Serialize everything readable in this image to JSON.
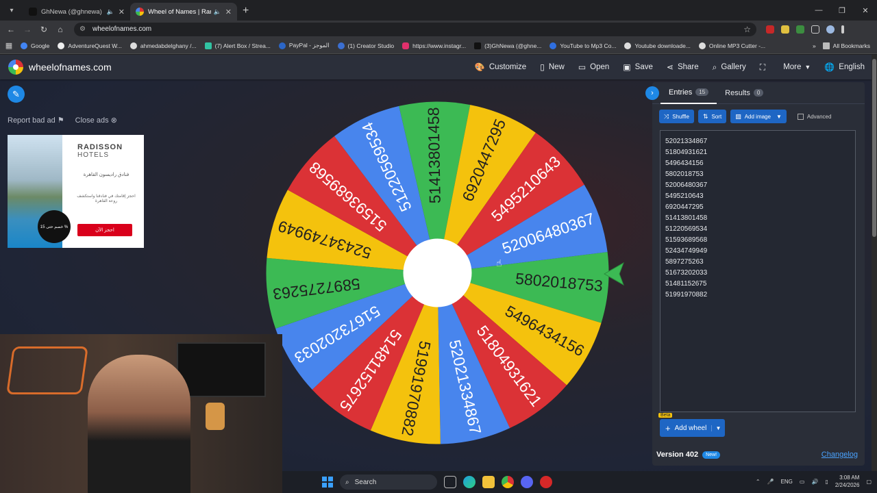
{
  "browser": {
    "tabs": [
      {
        "title": "GhNewa (@ghnewa) is LIVE",
        "active": false
      },
      {
        "title": "Wheel of Names | Random",
        "active": true
      }
    ],
    "url": "wheelofnames.com",
    "bookmarks": [
      "Google",
      "AdventureQuest W...",
      "ahmedabdelghany /...",
      "(7) Alert Box / Strea...",
      "PayPal - الموجز",
      "(1) Creator Studio",
      "https://www.instagr...",
      "(3)GhNewa (@ghne...",
      "YouTube to Mp3 Co...",
      "Youtube downloade...",
      "Online MP3 Cutter -..."
    ],
    "all_bookmarks": "All Bookmarks"
  },
  "app": {
    "brand": "wheelofnames.com",
    "menu": [
      {
        "label": "Customize",
        "icon": "palette-icon"
      },
      {
        "label": "New",
        "icon": "new-file-icon"
      },
      {
        "label": "Open",
        "icon": "folder-icon"
      },
      {
        "label": "Save",
        "icon": "save-icon"
      },
      {
        "label": "Share",
        "icon": "share-icon"
      },
      {
        "label": "Gallery",
        "icon": "search-icon"
      },
      {
        "label": "",
        "icon": "fullscreen-icon"
      },
      {
        "label": "More",
        "icon": "chevron-down-icon"
      },
      {
        "label": "English",
        "icon": "globe-icon"
      }
    ],
    "report_bad_ad": "Report bad ad",
    "close_ads": "Close ads"
  },
  "ad": {
    "brand": "RADISSON",
    "brand_sub": "HOTELS",
    "headline": "فنادق راديسون القاهرة",
    "body": "احجز إقامتك في فنادقنا واستكشف روعة القاهرة",
    "cta": "احجز الآن",
    "badge": "خصم حتى 15 %"
  },
  "wheel": {
    "slices": [
      {
        "label": "5802018753",
        "color": "#3cba54"
      },
      {
        "label": "5496434156",
        "color": "#f4c20d"
      },
      {
        "label": "51804931621",
        "color": "#db3236"
      },
      {
        "label": "52021334867",
        "color": "#4885ed"
      },
      {
        "label": "51991970882",
        "color": "#f4c20d"
      },
      {
        "label": "51481152675",
        "color": "#db3236"
      },
      {
        "label": "51673202033",
        "color": "#4885ed"
      },
      {
        "label": "5897275263",
        "color": "#3cba54"
      },
      {
        "label": "52434749949",
        "color": "#f4c20d"
      },
      {
        "label": "51593689568",
        "color": "#db3236"
      },
      {
        "label": "51220569534",
        "color": "#4885ed"
      },
      {
        "label": "51413801458",
        "color": "#3cba54"
      },
      {
        "label": "6920447295",
        "color": "#f4c20d"
      },
      {
        "label": "5495210643",
        "color": "#db3236"
      },
      {
        "label": "52006480367",
        "color": "#4885ed"
      }
    ]
  },
  "panel": {
    "tab_entries": "Entries",
    "entries_count": "15",
    "tab_results": "Results",
    "results_count": "0",
    "shuffle": "Shuffle",
    "sort": "Sort",
    "add_image": "Add image",
    "advanced": "Advanced",
    "entries": [
      "52021334867",
      "51804931621",
      "5496434156",
      "5802018753",
      "52006480367",
      "5495210643",
      "6920447295",
      "51413801458",
      "51220569534",
      "51593689568",
      "52434749949",
      "5897275263",
      "51673202033",
      "51481152675",
      "51991970882"
    ],
    "beta": "Beta",
    "add_wheel": "Add wheel",
    "version": "Version 402",
    "new_badge": "New!",
    "changelog": "Changelog"
  },
  "taskbar": {
    "search": "Search",
    "lang": "ENG",
    "time": "3:08 AM",
    "date": "2/24/2026"
  }
}
